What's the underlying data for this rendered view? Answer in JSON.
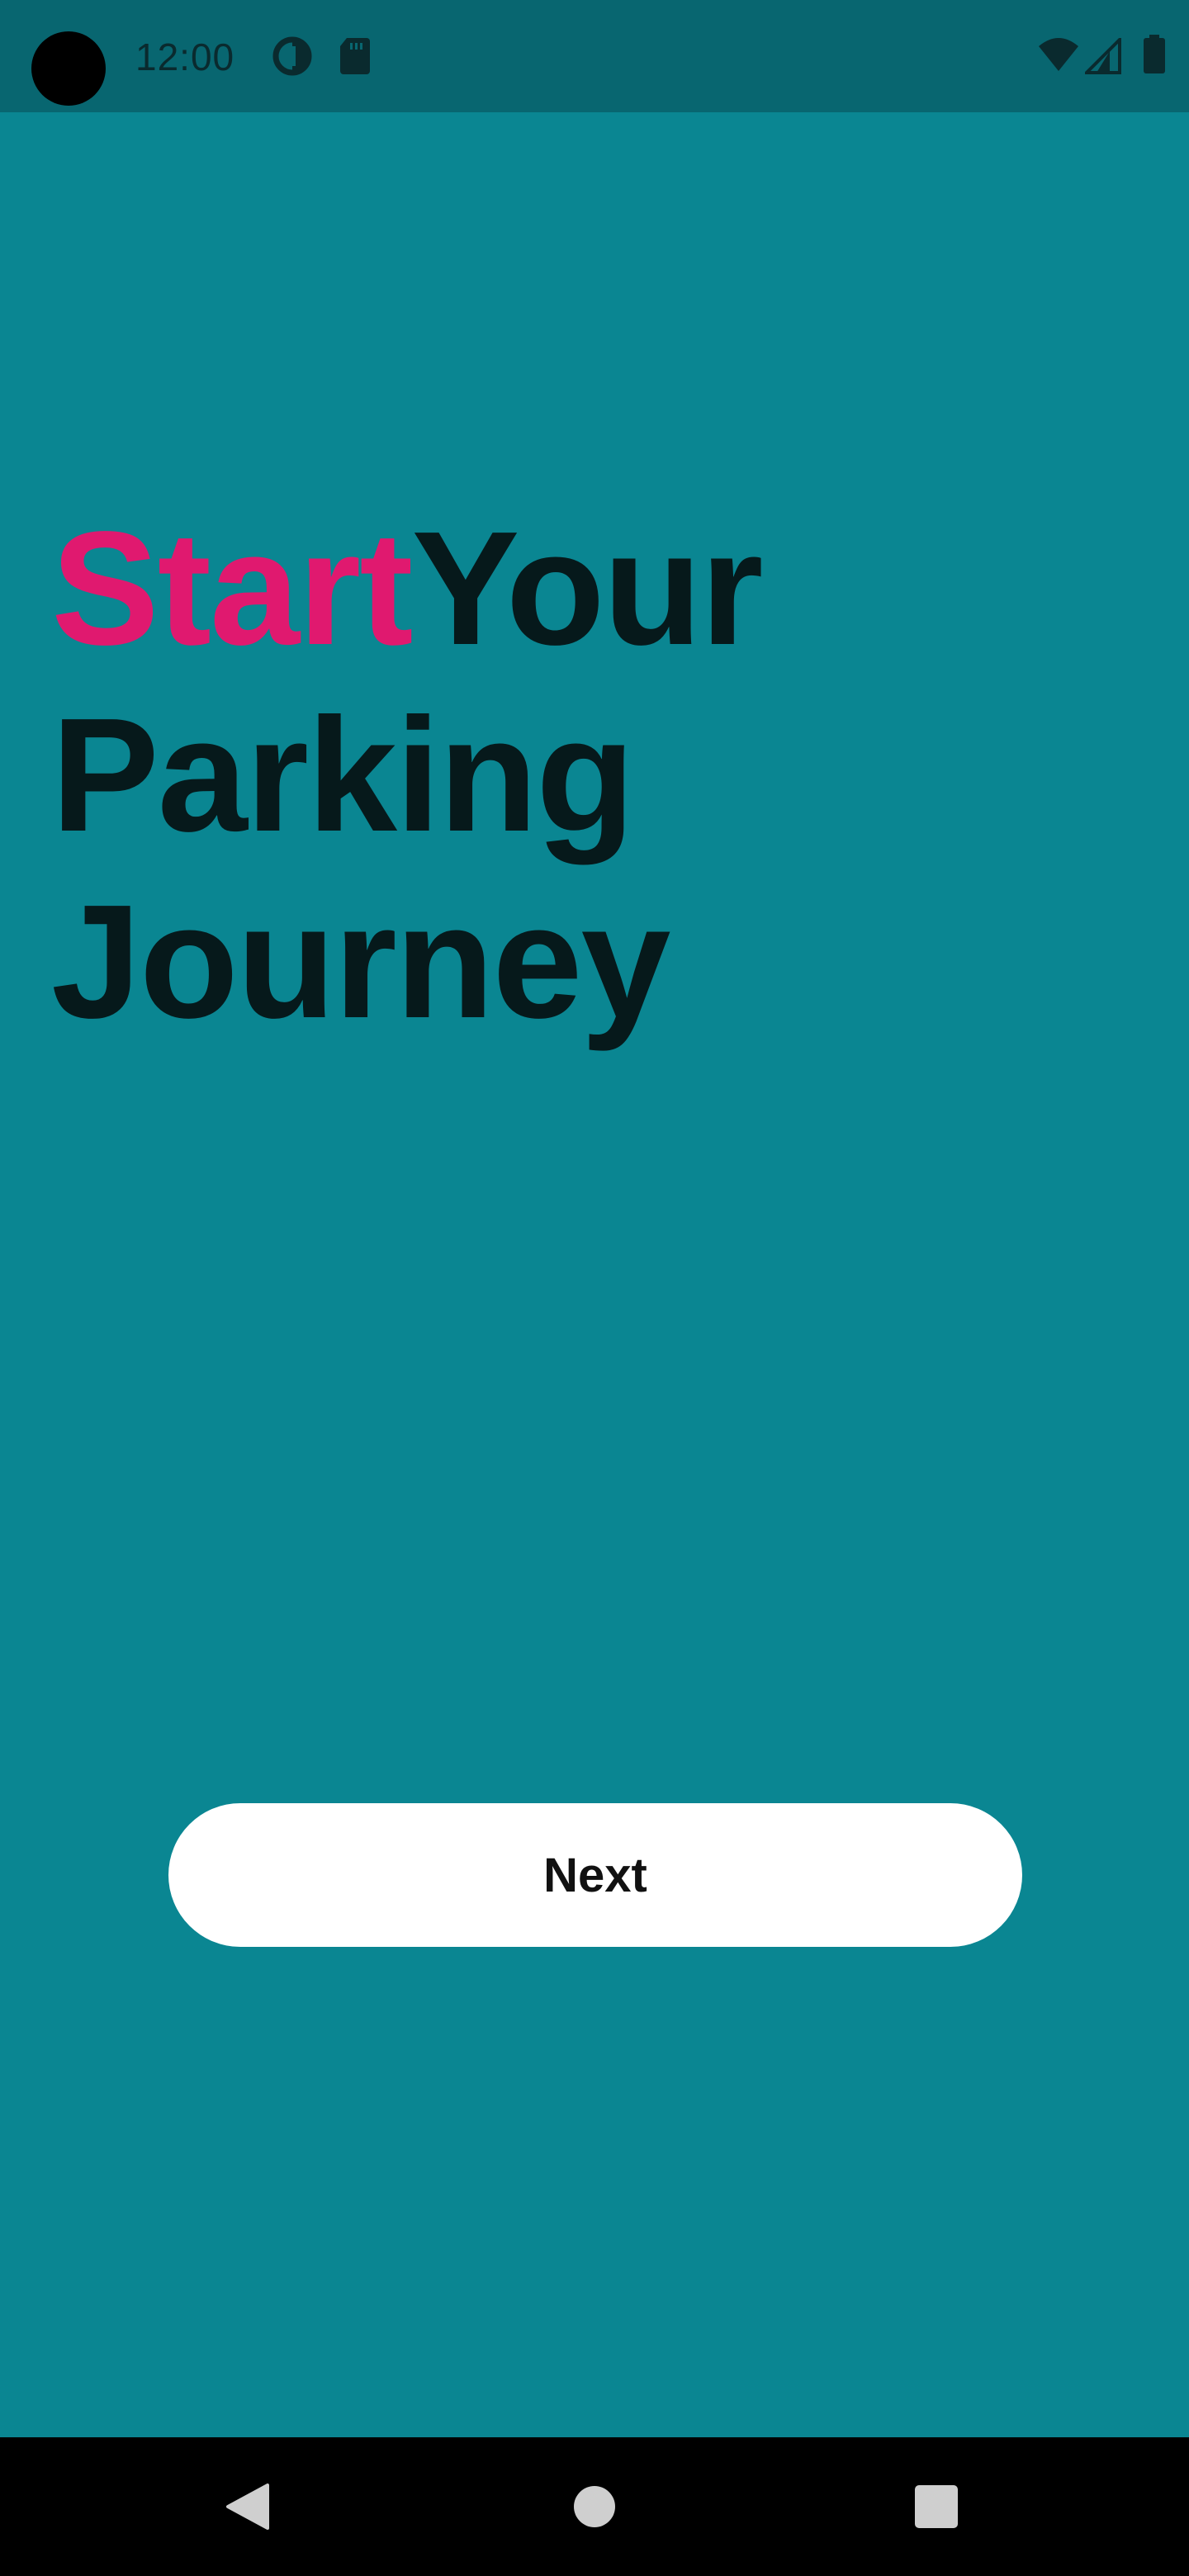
{
  "status_bar": {
    "time": "12:00",
    "icons": [
      "camera-cutout",
      "data-saver-icon",
      "sd-card-icon",
      "wifi-icon",
      "cell-signal-icon",
      "battery-icon"
    ]
  },
  "headline": {
    "accent_word": "Start",
    "line1_rest": "Your",
    "line2": "Parking",
    "line3": "Journey"
  },
  "actions": {
    "next_label": "Next"
  },
  "nav_bar": {
    "icons": [
      "back-icon",
      "home-icon",
      "recents-icon"
    ]
  },
  "colors": {
    "background": "#0a8692",
    "status_bar": "#086670",
    "accent": "#e0196f",
    "headline_text": "#06191b",
    "button_bg": "#ffffff",
    "nav_bar": "#000000"
  }
}
